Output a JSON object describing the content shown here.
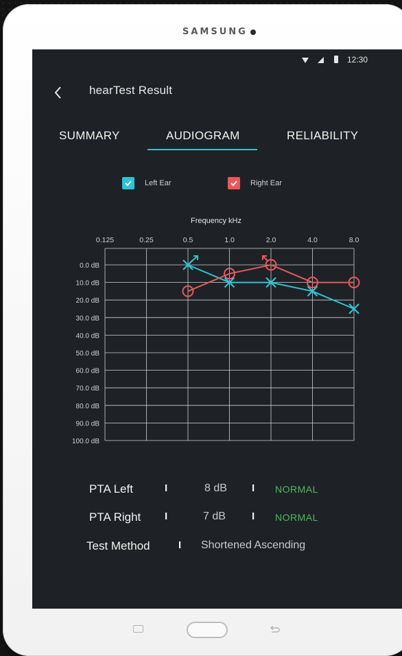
{
  "device": {
    "brand": "SAMSUNG"
  },
  "status_bar": {
    "time": "12:30"
  },
  "header": {
    "title": "hearTest Result"
  },
  "tabs": [
    {
      "label": "SUMMARY",
      "active": false
    },
    {
      "label": "AUDIOGRAM",
      "active": true
    },
    {
      "label": "RELIABILITY",
      "active": false
    }
  ],
  "legend": {
    "left": {
      "label": "Left Ear",
      "checked": true,
      "color": "#2fc4d4"
    },
    "right": {
      "label": "Right Ear",
      "checked": true,
      "color": "#e8595c"
    }
  },
  "chart_data": {
    "type": "line",
    "title": "Frequency kHz",
    "x_ticks": [
      "0.125",
      "0.25",
      "0.5",
      "1.0",
      "2.0",
      "4.0",
      "8.0"
    ],
    "y_ticks": [
      "0.0 dB",
      "10.0 dB",
      "20.0 dB",
      "30.0 dB",
      "40.0 dB",
      "50.0 dB",
      "60.0 dB",
      "70.0 dB",
      "80.0 dB",
      "90.0 dB",
      "100.0 dB"
    ],
    "ylim": [
      0,
      100
    ],
    "y_inverted": true,
    "grid": true,
    "series": [
      {
        "name": "Left Ear",
        "color": "#2fc4d4",
        "marker": "x",
        "x": [
          "0.5",
          "1.0",
          "2.0",
          "4.0",
          "8.0"
        ],
        "values": [
          0,
          10,
          10,
          15,
          25
        ]
      },
      {
        "name": "Right Ear",
        "color": "#e8595c",
        "marker": "o",
        "x": [
          "0.5",
          "1.0",
          "2.0",
          "4.0",
          "8.0"
        ],
        "values": [
          15,
          5,
          0,
          10,
          10
        ]
      }
    ]
  },
  "summary": {
    "pta_left": {
      "label": "PTA Left",
      "separator": "I",
      "value": "8 dB",
      "status": "NORMAL"
    },
    "pta_right": {
      "label": "PTA Right",
      "separator": "I",
      "value": "7 dB",
      "status": "NORMAL"
    },
    "test_method": {
      "label": "Test Method",
      "separator": "I",
      "value": "Shortened Ascending"
    }
  },
  "colors": {
    "accent": "#2fc4d4",
    "right_ear": "#e8595c",
    "normal": "#52b85e",
    "screen_bg": "#1e2226"
  }
}
